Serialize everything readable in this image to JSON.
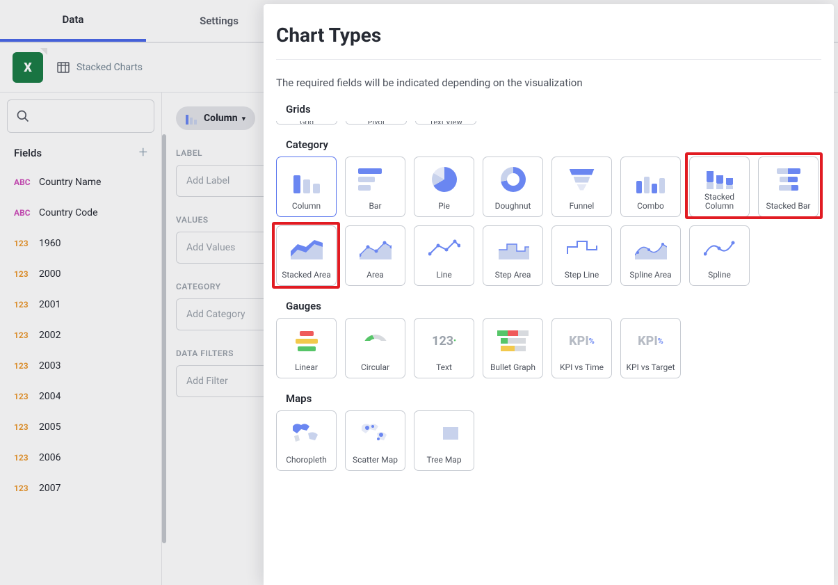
{
  "tabs": {
    "data": "Data",
    "settings": "Settings"
  },
  "datasource": {
    "name": "Stacked Charts"
  },
  "sidebar": {
    "fields_title": "Fields",
    "fields": [
      {
        "type": "ABC",
        "name": "Country Name"
      },
      {
        "type": "ABC",
        "name": "Country Code"
      },
      {
        "type": "123",
        "name": "1960"
      },
      {
        "type": "123",
        "name": "2000"
      },
      {
        "type": "123",
        "name": "2001"
      },
      {
        "type": "123",
        "name": "2002"
      },
      {
        "type": "123",
        "name": "2003"
      },
      {
        "type": "123",
        "name": "2004"
      },
      {
        "type": "123",
        "name": "2005"
      },
      {
        "type": "123",
        "name": "2006"
      },
      {
        "type": "123",
        "name": "2007"
      }
    ]
  },
  "config": {
    "viz_name": "Column",
    "sections": {
      "label": "LABEL",
      "label_placeholder": "Add Label",
      "values": "VALUES",
      "values_placeholder": "Add Values",
      "category": "CATEGORY",
      "category_placeholder": "Add Category",
      "filters": "DATA FILTERS",
      "filters_placeholder": "Add Filter"
    }
  },
  "panel": {
    "title": "Chart Types",
    "subtitle": "The required fields will be indicated depending on the visualization",
    "sections": {
      "grids": {
        "title": "Grids",
        "items": [
          "Grid",
          "Pivot",
          "Text View"
        ]
      },
      "category": {
        "title": "Category",
        "items": [
          "Column",
          "Bar",
          "Pie",
          "Doughnut",
          "Funnel",
          "Combo",
          "Stacked Column",
          "Stacked Bar",
          "Stacked Area",
          "Area",
          "Line",
          "Step Area",
          "Step Line",
          "Spline Area",
          "Spline"
        ]
      },
      "gauges": {
        "title": "Gauges",
        "items": [
          "Linear",
          "Circular",
          "Text",
          "Bullet Graph",
          "KPI vs Time",
          "KPI vs Target"
        ]
      },
      "maps": {
        "title": "Maps",
        "items": [
          "Choropleth",
          "Scatter Map",
          "Tree Map"
        ]
      }
    },
    "selected": "Column",
    "highlighted": [
      "Stacked Column",
      "Stacked Bar",
      "Stacked Area"
    ]
  }
}
